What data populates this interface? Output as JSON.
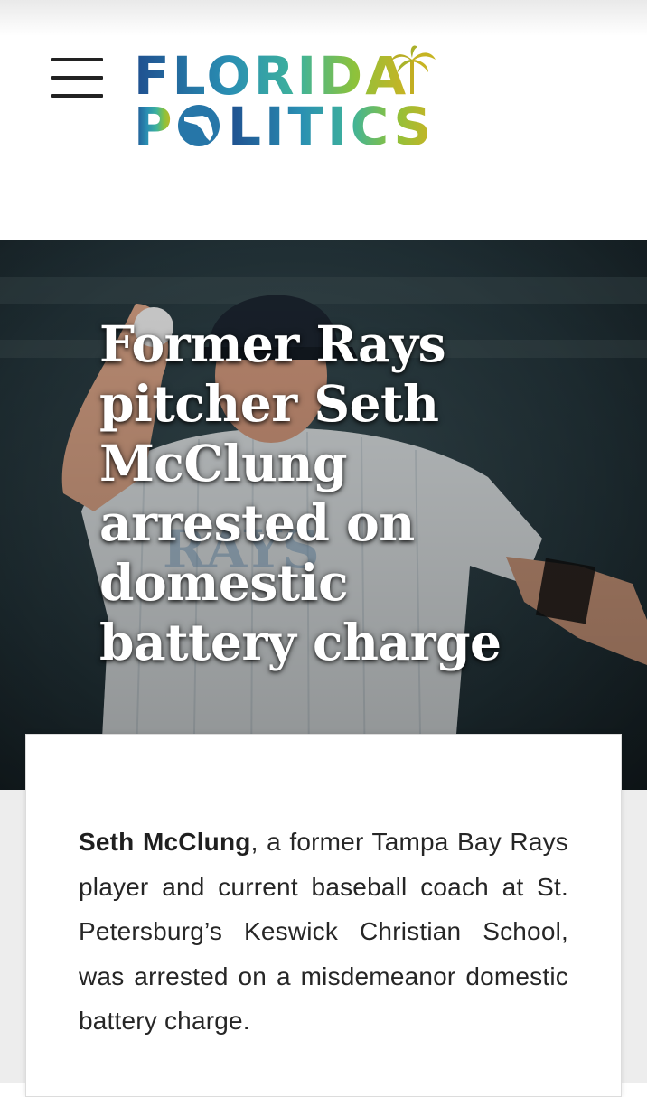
{
  "header": {
    "menu_label": "Menu",
    "logo": {
      "line1": "FLORIDA",
      "line2_o": "P",
      "line2_rest": "LITICS",
      "icons": [
        "palm-tree-icon",
        "florida-state-icon"
      ]
    }
  },
  "hero": {
    "title": "Former Rays pitcher Seth McClung arrested on domestic battery charge",
    "photo_icon": "baseball-pitcher-photo"
  },
  "article": {
    "lead_name": "Seth McClung",
    "lead_text": ", a former Tampa Bay Rays player and current baseball coach at St. Petersburg’s Keswick Christian School, was arrested on a misdemeanor domestic battery charge."
  },
  "colors": {
    "logo_blue": "#1f4f8f",
    "logo_teal": "#25a9b0",
    "logo_green": "#7fbf3f",
    "logo_gold": "#c9b424",
    "text": "#262626",
    "hero_overlay": "#1c2a30"
  }
}
